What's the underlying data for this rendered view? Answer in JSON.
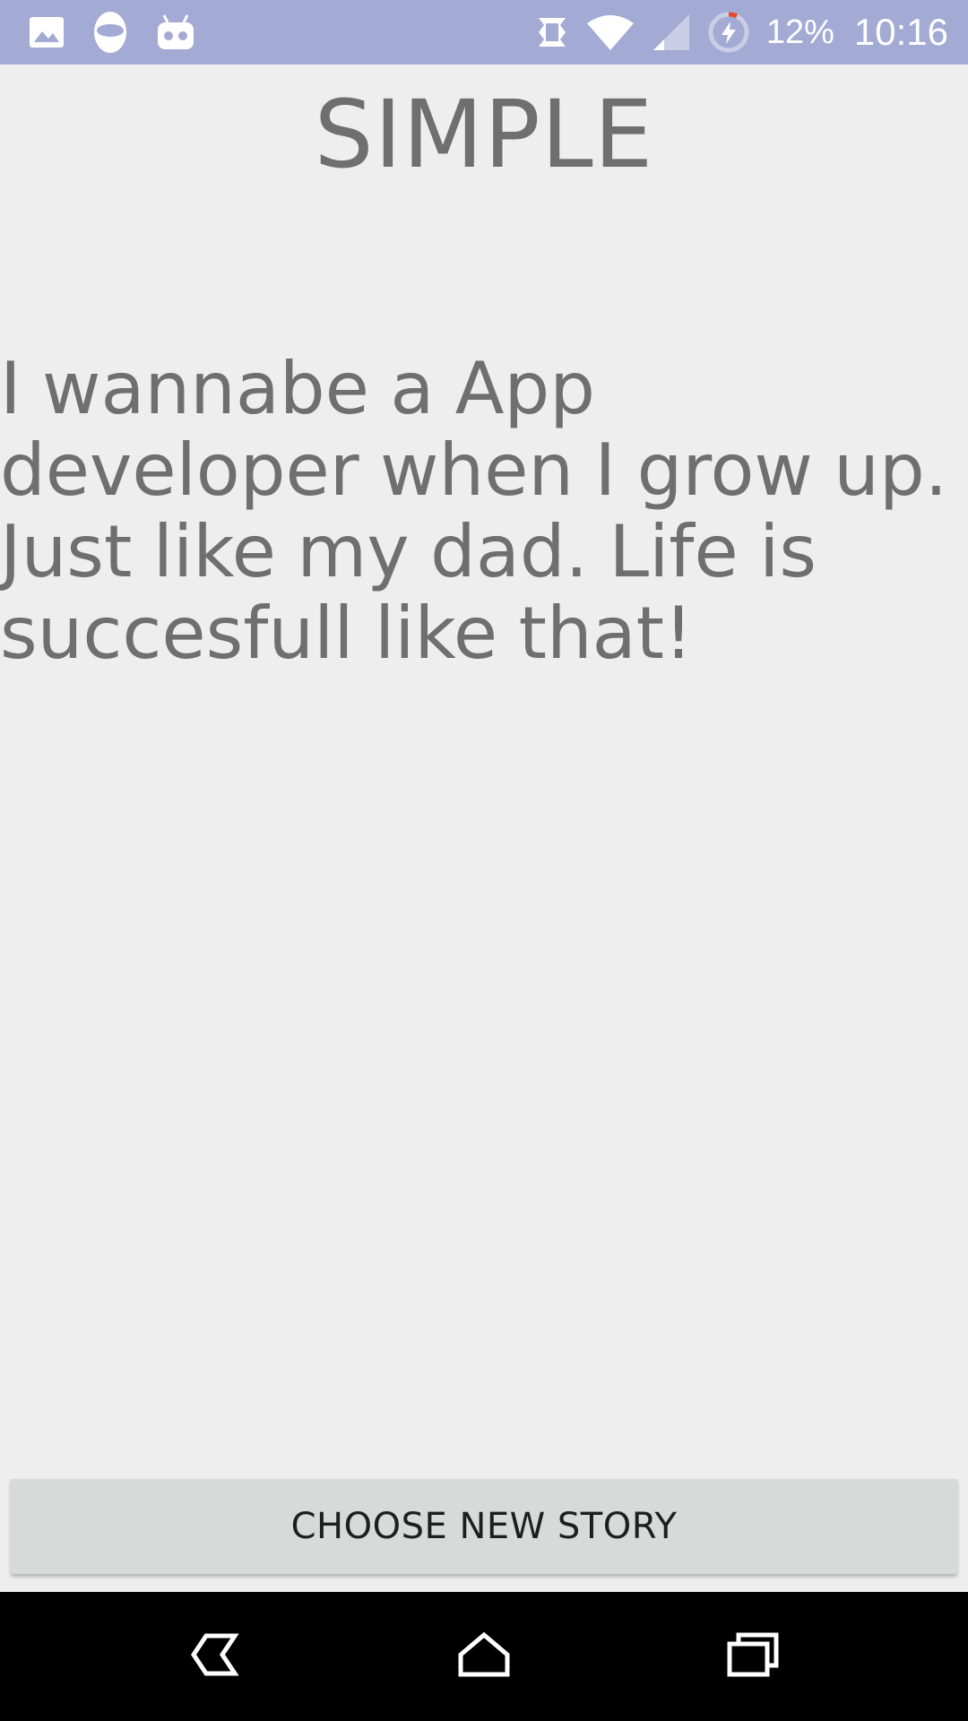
{
  "status_bar": {
    "background_color": "#a3aad3",
    "left_icons": [
      "gallery-icon",
      "cyanogen-icon",
      "android-debug-icon"
    ],
    "right_icons": [
      "vibrate-icon",
      "wifi-icon",
      "cell-signal-icon",
      "battery-charging-icon"
    ],
    "battery_percent": "12%",
    "time": "10:16"
  },
  "main": {
    "title": "SIMPLE",
    "story_text": "I wannabe a App developer when I grow up. Just like my dad. Life is succesfull like that!",
    "text_color": "#6f6f6f",
    "background_color": "#eeeeee"
  },
  "action": {
    "button_label": "CHOOSE NEW STORY"
  },
  "nav_bar": {
    "buttons": [
      "back-icon",
      "home-icon",
      "recents-icon"
    ]
  }
}
